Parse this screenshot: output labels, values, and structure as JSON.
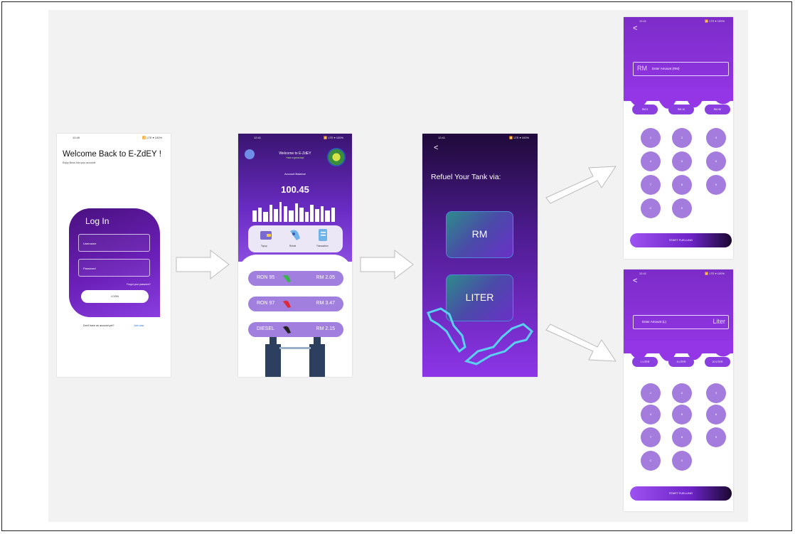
{
  "status": {
    "time1": "12:49",
    "time2": "12:41",
    "icons": "📶 LTE ▾ 100%"
  },
  "login": {
    "welcome": "Welcome Back to E-ZdEY !",
    "subtitle": "Enjoy Boos Into your account!",
    "title": "Log In",
    "username_placeholder": "Username",
    "password_placeholder": "Password",
    "forgot": "Forgot your password?",
    "login_button": "LOGIN",
    "no_account": "Don't have an account yet?",
    "join": "Join now"
  },
  "home": {
    "title": "Welcome to E-ZdEY",
    "tagline": "Have a great day!",
    "balance_label": "Account Balance",
    "balance": "100.45",
    "menu": [
      "Topup",
      "Refuel",
      "Transaction"
    ],
    "fuels": [
      {
        "name": "RON 95",
        "price": "RM 2.05",
        "color": "#39b54a"
      },
      {
        "name": "RON 97",
        "price": "RM 3.47",
        "color": "#e0283a"
      },
      {
        "name": "DIESEL",
        "price": "RM 2.15",
        "color": "#222222"
      }
    ]
  },
  "refuel": {
    "back": "<",
    "question": "Refuel Your Tank via:",
    "option_rm": "RM",
    "option_liter": "LITER"
  },
  "amount_rm": {
    "back": "<",
    "prefix": "RM",
    "placeholder": "Enter Amount (RM)",
    "chips": [
      "RM 5",
      "RM 10",
      "RM 50"
    ],
    "keys": [
      "1",
      "2",
      "3",
      "4",
      "5",
      "6",
      "7",
      "8",
      "9",
      "C",
      "0"
    ],
    "start": "START FUELLING"
  },
  "amount_liter": {
    "back": "<",
    "placeholder": "Enter Amount (L)",
    "suffix": "Liter",
    "chips": [
      "1 LITER",
      "5 LITER",
      "10 LITER"
    ],
    "keys": [
      "1",
      "2",
      "3",
      "4",
      "5",
      "6",
      "7",
      "8",
      "9",
      "C",
      "0"
    ],
    "start": "START FUELLING"
  },
  "colors": {
    "primary": "#7c2cc8",
    "accent": "#a47cde",
    "dark": "#1f0a3a"
  }
}
